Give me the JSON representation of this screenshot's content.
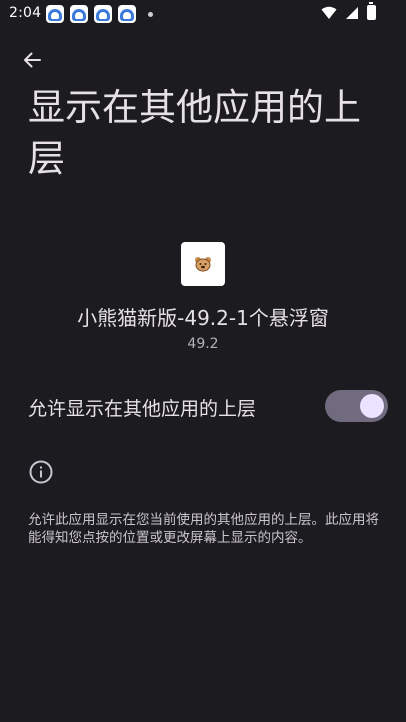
{
  "status_bar": {
    "time": "2:04",
    "notification_icons": [
      "app-notification-icon",
      "app-notification-icon",
      "app-notification-icon",
      "app-notification-icon"
    ]
  },
  "header": {
    "title": "显示在其他应用的上层"
  },
  "app": {
    "name": "小熊猫新版-49.2-1个悬浮窗",
    "version": "49.2"
  },
  "permission": {
    "label": "允许显示在其他应用的上层",
    "enabled": true
  },
  "info": {
    "text": "允许此应用显示在您当前使用的其他应用的上层。此应用将能得知您点按的位置或更改屏幕上显示的内容。"
  },
  "colors": {
    "background": "#1c1b1f",
    "switch_track": "#716b80",
    "switch_thumb": "#ebe3ff"
  }
}
